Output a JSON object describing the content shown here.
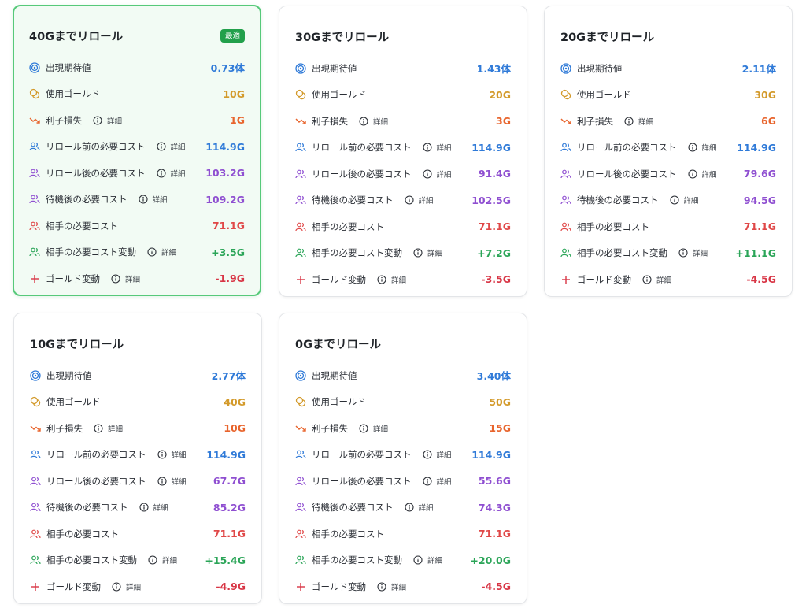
{
  "common": {
    "detail_label": "詳細",
    "rows": {
      "expected": "出現期待値",
      "gold_used": "使用ゴールド",
      "interest_loss": "利子損失",
      "cost_before": "リロール前の必要コスト",
      "cost_after": "リロール後の必要コスト",
      "cost_wait": "待機後の必要コスト",
      "opp_cost": "相手の必要コスト",
      "opp_cost_change": "相手の必要コスト変動",
      "gold_change": "ゴールド変動"
    }
  },
  "colors": {
    "blue": "#2f7ad8",
    "gold": "#d39a2b",
    "orange": "#e8642c",
    "purple": "#8f4fd1",
    "red": "#e04848",
    "green": "#2ba558",
    "crimson": "#d83545",
    "best_border": "#57c97a",
    "badge": "#22a04b"
  },
  "cards": [
    {
      "title": "40Gまでリロール",
      "badge": "最適",
      "values": {
        "expected": "0.73体",
        "gold_used": "10G",
        "interest_loss": "1G",
        "cost_before": "114.9G",
        "cost_after": "103.2G",
        "cost_wait": "109.2G",
        "opp_cost": "71.1G",
        "opp_cost_change": "+3.5G",
        "gold_change": "-1.9G"
      }
    },
    {
      "title": "30Gまでリロール",
      "values": {
        "expected": "1.43体",
        "gold_used": "20G",
        "interest_loss": "3G",
        "cost_before": "114.9G",
        "cost_after": "91.4G",
        "cost_wait": "102.5G",
        "opp_cost": "71.1G",
        "opp_cost_change": "+7.2G",
        "gold_change": "-3.5G"
      }
    },
    {
      "title": "20Gまでリロール",
      "values": {
        "expected": "2.11体",
        "gold_used": "30G",
        "interest_loss": "6G",
        "cost_before": "114.9G",
        "cost_after": "79.6G",
        "cost_wait": "94.5G",
        "opp_cost": "71.1G",
        "opp_cost_change": "+11.1G",
        "gold_change": "-4.5G"
      }
    },
    {
      "title": "10Gまでリロール",
      "values": {
        "expected": "2.77体",
        "gold_used": "40G",
        "interest_loss": "10G",
        "cost_before": "114.9G",
        "cost_after": "67.7G",
        "cost_wait": "85.2G",
        "opp_cost": "71.1G",
        "opp_cost_change": "+15.4G",
        "gold_change": "-4.9G"
      }
    },
    {
      "title": "0Gまでリロール",
      "values": {
        "expected": "3.40体",
        "gold_used": "50G",
        "interest_loss": "15G",
        "cost_before": "114.9G",
        "cost_after": "55.6G",
        "cost_wait": "74.3G",
        "opp_cost": "71.1G",
        "opp_cost_change": "+20.0G",
        "gold_change": "-4.5G"
      }
    }
  ]
}
